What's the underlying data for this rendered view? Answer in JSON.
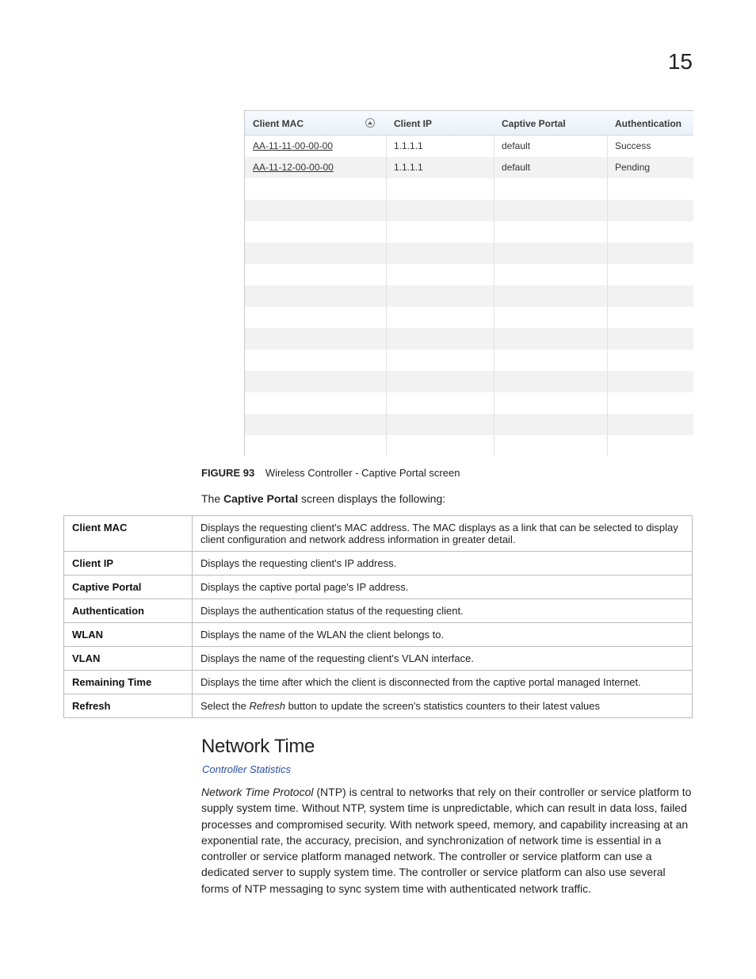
{
  "page_number": "15",
  "screenshot": {
    "headers": [
      "Client MAC",
      "Client IP",
      "Captive Portal",
      "Authentication"
    ],
    "rows": [
      {
        "mac": "AA-11-11-00-00-00",
        "ip": "1.1.1.1",
        "portal": "default",
        "auth": "Success"
      },
      {
        "mac": "AA-11-12-00-00-00",
        "ip": "1.1.1.1",
        "portal": "default",
        "auth": "Pending"
      }
    ],
    "empty_rows": 13
  },
  "figure": {
    "label": "FIGURE 93",
    "caption": "Wireless Controller - Captive Portal screen"
  },
  "intro": {
    "prefix": "The ",
    "bold": "Captive Portal",
    "suffix": " screen displays the following:"
  },
  "desc_rows": [
    {
      "term": "Client MAC",
      "desc": "Displays the requesting client's MAC address. The MAC displays as a link that can be selected to display client configuration and network address information in greater detail."
    },
    {
      "term": "Client IP",
      "desc": "Displays the requesting client's IP address."
    },
    {
      "term": "Captive Portal",
      "desc": "Displays the captive portal page's IP address."
    },
    {
      "term": "Authentication",
      "desc": "Displays the authentication status of the requesting client."
    },
    {
      "term": "WLAN",
      "desc": "Displays the name of the WLAN the client belongs to."
    },
    {
      "term": "VLAN",
      "desc": "Displays the name of the requesting client's VLAN interface."
    },
    {
      "term": "Remaining Time",
      "desc": "Displays the time after which the client is disconnected from the captive portal managed Internet."
    },
    {
      "term": "Refresh",
      "desc_prefix": "Select the ",
      "desc_italic": "Refresh",
      "desc_suffix": " button to update the screen's statistics counters to their latest values"
    }
  ],
  "section": {
    "heading": "Network Time",
    "link": "Controller Statistics",
    "para_italic": "Network Time Protocol",
    "para_rest": " (NTP) is central to networks that rely on their controller or service platform to supply system time. Without NTP, system time is unpredictable, which can result in data loss, failed processes and compromised security. With network speed, memory, and capability increasing at an exponential rate, the accuracy, precision, and synchronization of network time is essential in a controller or service platform managed network. The controller or service platform can use a dedicated server to supply system time. The controller or service platform can also use several forms of NTP messaging to sync system time with authenticated network traffic."
  }
}
